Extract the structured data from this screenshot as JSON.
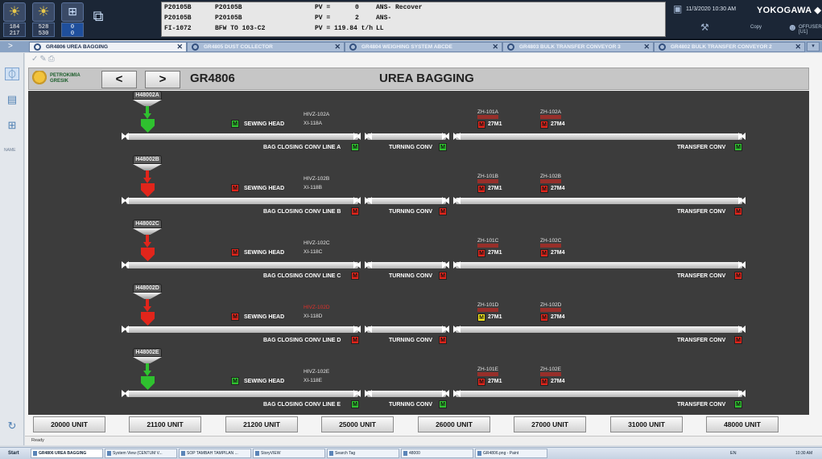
{
  "system_bar": {
    "counters": [
      {
        "top": "184",
        "bottom": "217"
      },
      {
        "top": "528",
        "bottom": "530"
      },
      {
        "top": "0",
        "bottom": "0"
      }
    ],
    "alarm_rows": [
      {
        "c1": "P20105B",
        "c2": "P20105B",
        "c3": "PV =",
        "c4": "0",
        "c5": "ANS- Recover"
      },
      {
        "c1": "P20105B",
        "c2": "P20105B",
        "c3": "PV =",
        "c4": "2",
        "c5": "ANS-"
      },
      {
        "c1": "FI-1072",
        "c2": "BFW TO 103-C2",
        "c3": "PV = 119.84 t/h",
        "c4": "",
        "c5": "LL"
      }
    ],
    "datetime": "11/3/2020 10:30 AM",
    "brand": "YOKOGAWA ◆",
    "copy_label": "Copy",
    "user_label": "OFFUSERA [U1]"
  },
  "tabs": [
    {
      "label": "GR4806 UREA BAGGING",
      "active": true
    },
    {
      "label": "GR4805 DUST COLLECTOR",
      "active": false
    },
    {
      "label": "GR4804 WEIGHING SYSTEM ABCDE",
      "active": false
    },
    {
      "label": "GR4803 BULK TRANSFER CONVEYOR 3",
      "active": false
    },
    {
      "label": "GR4802 BULK TRANSFER CONVEYOR 2",
      "active": false
    }
  ],
  "toolbar_left": {
    "name_label": "NAME"
  },
  "header": {
    "logo_line1": "PETROKIMIA",
    "logo_line2": "GRESIK",
    "prev_label": "<",
    "next_label": ">",
    "area_code": "GR4806",
    "area_title": "UREA BAGGING"
  },
  "lines": [
    {
      "hopper": "H48002A",
      "state": "green",
      "sewing_label": "SEWING HEAD",
      "sewing_state": "green",
      "hivz": "HIVZ-102A",
      "hivz_alarm": false,
      "xi": "XI-118A",
      "zh1": "ZH-101A",
      "zh1_sub": "27M1",
      "zh1_state": "red",
      "zh2": "ZH-102A",
      "zh2_sub": "27M4",
      "zh2_state": "red",
      "bag_closing": "BAG CLOSING CONV LINE A",
      "bag_closing_state": "green",
      "turning": "TURNING CONV",
      "turning_state": "green",
      "transfer": "TRANSFER CONV",
      "transfer_state": "green"
    },
    {
      "hopper": "H48002B",
      "state": "red",
      "sewing_label": "SEWING HEAD",
      "sewing_state": "red",
      "hivz": "HIVZ-102B",
      "hivz_alarm": false,
      "xi": "XI-118B",
      "zh1": "ZH-101B",
      "zh1_sub": "27M1",
      "zh1_state": "red",
      "zh2": "ZH-102B",
      "zh2_sub": "27M4",
      "zh2_state": "red",
      "bag_closing": "BAG CLOSING CONV LINE B",
      "bag_closing_state": "red",
      "turning": "TURNING CONV",
      "turning_state": "red",
      "transfer": "TRANSFER CONV",
      "transfer_state": "red"
    },
    {
      "hopper": "H48002C",
      "state": "red",
      "sewing_label": "SEWING HEAD",
      "sewing_state": "red",
      "hivz": "HIVZ-102C",
      "hivz_alarm": false,
      "xi": "XI-118C",
      "zh1": "ZH-101C",
      "zh1_sub": "27M1",
      "zh1_state": "red",
      "zh2": "ZH-102C",
      "zh2_sub": "27M4",
      "zh2_state": "red",
      "bag_closing": "BAG CLOSING CONV LINE C",
      "bag_closing_state": "red",
      "turning": "TURNING CONV",
      "turning_state": "red",
      "transfer": "TRANSFER CONV",
      "transfer_state": "red"
    },
    {
      "hopper": "H48002D",
      "state": "red",
      "sewing_label": "SEWING HEAD",
      "sewing_state": "red",
      "hivz": "HIVZ-102D",
      "hivz_alarm": true,
      "xi": "XI-118D",
      "zh1": "ZH-101D",
      "zh1_sub": "27M1",
      "zh1_state": "yellow",
      "zh2": "ZH-102D",
      "zh2_sub": "27M4",
      "zh2_state": "red",
      "bag_closing": "BAG CLOSING CONV LINE D",
      "bag_closing_state": "red",
      "turning": "TURNING CONV",
      "turning_state": "red",
      "transfer": "TRANSFER CONV",
      "transfer_state": "red"
    },
    {
      "hopper": "H48002E",
      "state": "green",
      "sewing_label": "SEWING HEAD",
      "sewing_state": "green",
      "hivz": "HIVZ-102E",
      "hivz_alarm": false,
      "xi": "XI-118E",
      "zh1": "ZH-101E",
      "zh1_sub": "27M1",
      "zh1_state": "red",
      "zh2": "ZH-102E",
      "zh2_sub": "27M4",
      "zh2_state": "red",
      "bag_closing": "BAG CLOSING CONV LINE E",
      "bag_closing_state": "green",
      "turning": "TURNING CONV",
      "turning_state": "green",
      "transfer": "TRANSFER CONV",
      "transfer_state": "green"
    }
  ],
  "motor_letter": "M",
  "units": [
    "20000 UNIT",
    "21100 UNIT",
    "21200 UNIT",
    "25000 UNIT",
    "26000 UNIT",
    "27000 UNIT",
    "31000 UNIT",
    "48000 UNIT"
  ],
  "status_text": "Ready",
  "taskbar": {
    "start": "Start",
    "tasks": [
      {
        "label": "GR4806 UREA BAGGING",
        "active": true
      },
      {
        "label": "System View (CENTUM V...",
        "active": false
      },
      {
        "label": "SOP TAMBAH TAMPILAN ...",
        "active": false
      },
      {
        "label": "StoryVIEW",
        "active": false
      },
      {
        "label": "Search Tag",
        "active": false
      },
      {
        "label": "48000",
        "active": false
      },
      {
        "label": "GR4806.png - Paint",
        "active": false
      }
    ],
    "lang": "EN",
    "time": "10:30 AM"
  },
  "colors": {
    "green": "#2fc12f",
    "red": "#e1251b",
    "yellow": "#f1e41b",
    "panel": "#3c3c3c"
  }
}
